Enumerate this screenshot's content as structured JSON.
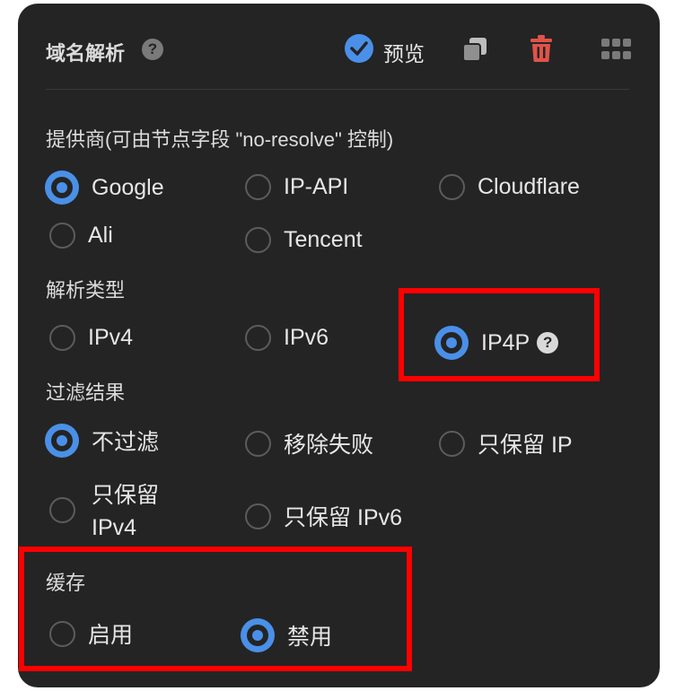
{
  "header": {
    "title": "域名解析",
    "help_glyph": "?",
    "preview_label": "预览",
    "icons": [
      "help-icon",
      "checkbox-checked-icon",
      "copy-icon",
      "trash-icon",
      "grid-icon"
    ]
  },
  "provider": {
    "label": "提供商(可由节点字段 \"no-resolve\" 控制)",
    "options": [
      "Google",
      "IP-API",
      "Cloudflare",
      "Ali",
      "Tencent"
    ],
    "selected": "Google"
  },
  "resolve_type": {
    "label": "解析类型",
    "options": [
      "IPv4",
      "IPv6",
      "IP4P"
    ],
    "selected": "IP4P",
    "help_glyph": "?"
  },
  "filter": {
    "label": "过滤结果",
    "options": [
      "不过滤",
      "移除失败",
      "只保留 IP",
      "只保留",
      "IPv4",
      "只保留 IPv6"
    ],
    "selected": "不过滤"
  },
  "cache": {
    "label": "缓存",
    "options": [
      "启用",
      "禁用"
    ],
    "selected": "禁用"
  },
  "colors": {
    "panel_bg": "#242424",
    "accent": "#4a90e8",
    "delete": "#e0534a",
    "highlight_box": "#ff0000"
  }
}
